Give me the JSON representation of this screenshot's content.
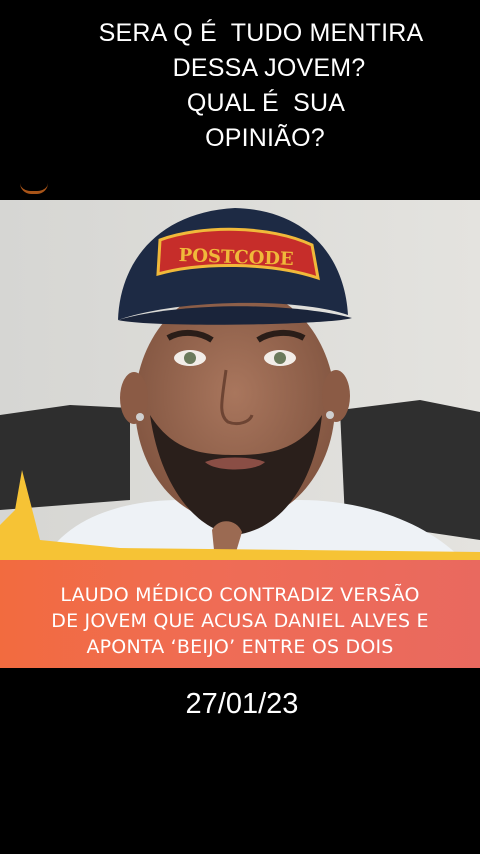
{
  "caption": {
    "lines": [
      "SERA Q É  TUDO MENTIRA",
      "DESSA JOVEM?",
      "QUAL É  SUA",
      "OPINIÃO?"
    ]
  },
  "photo": {
    "cap_text": "POSTCODE"
  },
  "banner": {
    "lines": [
      "LAUDO MÉDICO CONTRADIZ VERSÃO",
      "DE JOVEM QUE ACUSA DANIEL ALVES E",
      "APONTA ‘BEIJO’ ENTRE OS DOIS"
    ]
  },
  "date": "27/01/23"
}
